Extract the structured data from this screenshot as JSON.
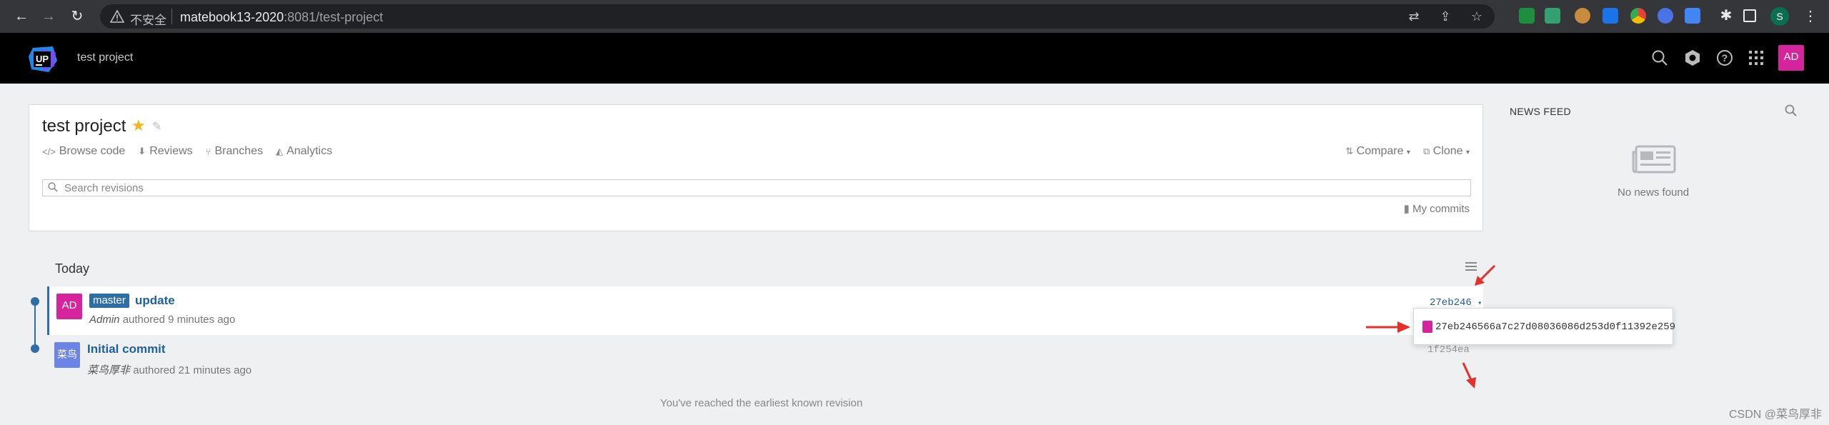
{
  "browser": {
    "insecure_label": "不安全",
    "url_host": "matebook13-2020",
    "url_rest": ":8081/test-project",
    "profile_initial": "S"
  },
  "header": {
    "logo_text": "UP",
    "project_name": "test project",
    "user_initials": "AD"
  },
  "project": {
    "title": "test project",
    "tabs": [
      {
        "icon": "code-icon",
        "label": "Browse code"
      },
      {
        "icon": "reviews-icon",
        "label": "Reviews"
      },
      {
        "icon": "branch-icon",
        "label": "Branches"
      },
      {
        "icon": "analytics-icon",
        "label": "Analytics"
      }
    ],
    "compare_label": "Compare",
    "clone_label": "Clone",
    "search_placeholder": "Search revisions",
    "my_commits_label": "My commits"
  },
  "timeline": {
    "group_label": "Today",
    "commits": [
      {
        "avatar": "AD",
        "branch": "master",
        "message": "update",
        "author": "Admin",
        "authored_text": "authored 9 minutes ago",
        "short_hash": "27eb246",
        "full_hash": "27eb246566a7c27d08036086d253d0f11392e259"
      },
      {
        "avatar": "菜鸟",
        "branch": "",
        "message": "Initial commit",
        "author": "菜鸟厚非",
        "authored_text": "authored 21 minutes ago",
        "short_hash": "1f254ea"
      }
    ],
    "end_text": "You've reached the earliest known revision"
  },
  "news": {
    "title": "NEWS FEED",
    "empty_text": "No news found"
  },
  "watermark": "CSDN @菜鸟厚非",
  "colors": {
    "accent": "#2d6ea8",
    "avatar_admin": "#d6249f",
    "avatar_user": "#6b84e6",
    "annotation_arrow": "#e4302b"
  }
}
